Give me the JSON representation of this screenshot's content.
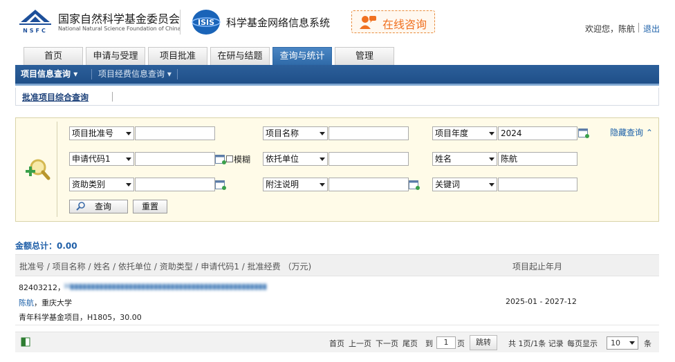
{
  "header": {
    "org_name_cn": "国家自然科学基金委员会",
    "org_name_en": "National Natural Science Foundation of China",
    "logo_text": "NSFC",
    "isis_logo_text": "ISIS",
    "system_name": "科学基金网络信息系统",
    "consult_label": "在线咨询",
    "welcome_text": "欢迎您，陈航",
    "logout_label": "退出"
  },
  "tabs": [
    {
      "label": "首页"
    },
    {
      "label": "申请与受理"
    },
    {
      "label": "项目批准"
    },
    {
      "label": "在研与结题"
    },
    {
      "label": "查询与统计",
      "active": true
    },
    {
      "label": "管理"
    }
  ],
  "subnav": {
    "items": [
      {
        "label": "项目信息查询",
        "active": true
      },
      {
        "label": "项目经费信息查询"
      }
    ],
    "breadcrumb": "批准项目综合查询"
  },
  "search": {
    "fields": [
      {
        "select": "项目批准号",
        "value": ""
      },
      {
        "select": "项目名称",
        "value": ""
      },
      {
        "select": "项目年度",
        "value": "2024"
      },
      {
        "select": "申请代码1",
        "value": ""
      },
      {
        "select": "依托单位",
        "value": ""
      },
      {
        "select": "姓名",
        "value": "陈航"
      },
      {
        "select": "资助类别",
        "value": ""
      },
      {
        "select": "附注说明",
        "value": ""
      },
      {
        "select": "关键词",
        "value": ""
      }
    ],
    "fuzzy_label": "模糊",
    "query_button": "查询",
    "reset_button": "重置",
    "hide_query_label": "隐藏查询"
  },
  "total": {
    "label": "金额总计：",
    "value": "0.00"
  },
  "results": {
    "header_main": "批准号 / 项目名称 / 姓名 / 依托单位 / 资助类型 / 申请代码1 / 批准经费 （万元)",
    "header_period": "项目起止年月",
    "rows": [
      {
        "line1_number": "82403212，",
        "line1_blurred": "H▮▮▮▮▮▮▮▮▮▮▮▮▮▮▮▮▮▮▮▮▮▮▮▮▮▮▮▮▮▮▮▮▮▮▮▮▮▮▮▮▮▮▮▮▮▮▮",
        "person": "陈航",
        "institution": "，重庆大学",
        "line3": "青年科学基金项目，H1805，30.00",
        "period": "2025-01 - 2027-12"
      }
    ]
  },
  "pager": {
    "first": "首页",
    "prev": "上一页",
    "next": "下一页",
    "last": "尾页",
    "goto_label": "到",
    "page_value": "1",
    "page_unit": "页",
    "jump_button": "跳转",
    "summary": "共 1页/1条 记录",
    "per_page_label": "每页显示",
    "per_page_value": "10",
    "per_page_unit": "条"
  },
  "colors": {
    "accent_blue": "#2f6aa8",
    "subnav_blue": "#1f4f88",
    "search_bg": "#fffbe8",
    "consult_orange": "#f07020"
  }
}
